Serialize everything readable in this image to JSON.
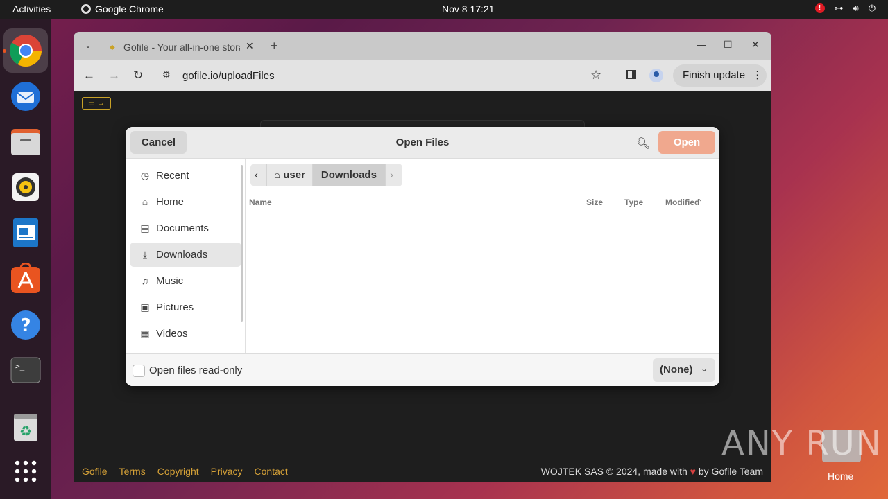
{
  "topbar": {
    "activities": "Activities",
    "app_name": "Google Chrome",
    "clock": "Nov 8  17:21",
    "alert_badge": "!"
  },
  "dock": {
    "items": [
      "google-chrome",
      "thunderbird",
      "files",
      "rhythmbox",
      "libreoffice-writer",
      "app-center",
      "help",
      "terminal",
      "trash",
      "show-apps"
    ]
  },
  "browser": {
    "tab_title": "Gofile - Your all-in-one storage solution",
    "url": "gofile.io/uploadFiles",
    "finish_update": "Finish update",
    "menu_toggle": "☰ →",
    "footer_links": [
      "Gofile",
      "Terms",
      "Copyright",
      "Privacy",
      "Contact"
    ],
    "footer_credit_prefix": "WOJTEK SAS © 2024, made with",
    "footer_credit_suffix": "by Gofile Team"
  },
  "dialog": {
    "title": "Open Files",
    "cancel": "Cancel",
    "open": "Open",
    "places": [
      {
        "label": "Recent",
        "icon": "clock-icon"
      },
      {
        "label": "Home",
        "icon": "home-icon"
      },
      {
        "label": "Documents",
        "icon": "document-icon"
      },
      {
        "label": "Downloads",
        "icon": "download-icon",
        "selected": true
      },
      {
        "label": "Music",
        "icon": "music-icon"
      },
      {
        "label": "Pictures",
        "icon": "picture-icon"
      },
      {
        "label": "Videos",
        "icon": "video-icon"
      }
    ],
    "path": [
      "user",
      "Downloads"
    ],
    "columns": {
      "name": "Name",
      "size": "Size",
      "type": "Type",
      "modified": "Modified"
    },
    "readonly_label": "Open files read-only",
    "filter": "(None)"
  },
  "desktop": {
    "home_label": "Home",
    "watermark": "ANY RUN"
  },
  "colors": {
    "accent": "#e95420",
    "open_button": "#f0a88e",
    "link": "#d4a037"
  }
}
